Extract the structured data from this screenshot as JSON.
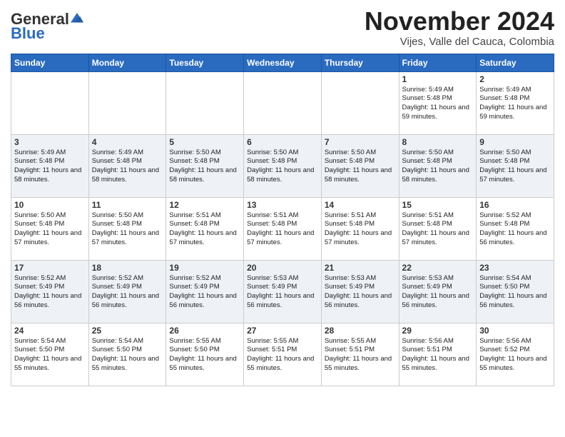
{
  "logo": {
    "general": "General",
    "blue": "Blue"
  },
  "header": {
    "month": "November 2024",
    "location": "Vijes, Valle del Cauca, Colombia"
  },
  "weekdays": [
    "Sunday",
    "Monday",
    "Tuesday",
    "Wednesday",
    "Thursday",
    "Friday",
    "Saturday"
  ],
  "rows": [
    [
      {
        "day": "",
        "text": ""
      },
      {
        "day": "",
        "text": ""
      },
      {
        "day": "",
        "text": ""
      },
      {
        "day": "",
        "text": ""
      },
      {
        "day": "",
        "text": ""
      },
      {
        "day": "1",
        "text": "Sunrise: 5:49 AM\nSunset: 5:48 PM\nDaylight: 11 hours and 59 minutes."
      },
      {
        "day": "2",
        "text": "Sunrise: 5:49 AM\nSunset: 5:48 PM\nDaylight: 11 hours and 59 minutes."
      }
    ],
    [
      {
        "day": "3",
        "text": "Sunrise: 5:49 AM\nSunset: 5:48 PM\nDaylight: 11 hours and 58 minutes."
      },
      {
        "day": "4",
        "text": "Sunrise: 5:49 AM\nSunset: 5:48 PM\nDaylight: 11 hours and 58 minutes."
      },
      {
        "day": "5",
        "text": "Sunrise: 5:50 AM\nSunset: 5:48 PM\nDaylight: 11 hours and 58 minutes."
      },
      {
        "day": "6",
        "text": "Sunrise: 5:50 AM\nSunset: 5:48 PM\nDaylight: 11 hours and 58 minutes."
      },
      {
        "day": "7",
        "text": "Sunrise: 5:50 AM\nSunset: 5:48 PM\nDaylight: 11 hours and 58 minutes."
      },
      {
        "day": "8",
        "text": "Sunrise: 5:50 AM\nSunset: 5:48 PM\nDaylight: 11 hours and 58 minutes."
      },
      {
        "day": "9",
        "text": "Sunrise: 5:50 AM\nSunset: 5:48 PM\nDaylight: 11 hours and 57 minutes."
      }
    ],
    [
      {
        "day": "10",
        "text": "Sunrise: 5:50 AM\nSunset: 5:48 PM\nDaylight: 11 hours and 57 minutes."
      },
      {
        "day": "11",
        "text": "Sunrise: 5:50 AM\nSunset: 5:48 PM\nDaylight: 11 hours and 57 minutes."
      },
      {
        "day": "12",
        "text": "Sunrise: 5:51 AM\nSunset: 5:48 PM\nDaylight: 11 hours and 57 minutes."
      },
      {
        "day": "13",
        "text": "Sunrise: 5:51 AM\nSunset: 5:48 PM\nDaylight: 11 hours and 57 minutes."
      },
      {
        "day": "14",
        "text": "Sunrise: 5:51 AM\nSunset: 5:48 PM\nDaylight: 11 hours and 57 minutes."
      },
      {
        "day": "15",
        "text": "Sunrise: 5:51 AM\nSunset: 5:48 PM\nDaylight: 11 hours and 57 minutes."
      },
      {
        "day": "16",
        "text": "Sunrise: 5:52 AM\nSunset: 5:48 PM\nDaylight: 11 hours and 56 minutes."
      }
    ],
    [
      {
        "day": "17",
        "text": "Sunrise: 5:52 AM\nSunset: 5:49 PM\nDaylight: 11 hours and 56 minutes."
      },
      {
        "day": "18",
        "text": "Sunrise: 5:52 AM\nSunset: 5:49 PM\nDaylight: 11 hours and 56 minutes."
      },
      {
        "day": "19",
        "text": "Sunrise: 5:52 AM\nSunset: 5:49 PM\nDaylight: 11 hours and 56 minutes."
      },
      {
        "day": "20",
        "text": "Sunrise: 5:53 AM\nSunset: 5:49 PM\nDaylight: 11 hours and 56 minutes."
      },
      {
        "day": "21",
        "text": "Sunrise: 5:53 AM\nSunset: 5:49 PM\nDaylight: 11 hours and 56 minutes."
      },
      {
        "day": "22",
        "text": "Sunrise: 5:53 AM\nSunset: 5:49 PM\nDaylight: 11 hours and 56 minutes."
      },
      {
        "day": "23",
        "text": "Sunrise: 5:54 AM\nSunset: 5:50 PM\nDaylight: 11 hours and 56 minutes."
      }
    ],
    [
      {
        "day": "24",
        "text": "Sunrise: 5:54 AM\nSunset: 5:50 PM\nDaylight: 11 hours and 55 minutes."
      },
      {
        "day": "25",
        "text": "Sunrise: 5:54 AM\nSunset: 5:50 PM\nDaylight: 11 hours and 55 minutes."
      },
      {
        "day": "26",
        "text": "Sunrise: 5:55 AM\nSunset: 5:50 PM\nDaylight: 11 hours and 55 minutes."
      },
      {
        "day": "27",
        "text": "Sunrise: 5:55 AM\nSunset: 5:51 PM\nDaylight: 11 hours and 55 minutes."
      },
      {
        "day": "28",
        "text": "Sunrise: 5:55 AM\nSunset: 5:51 PM\nDaylight: 11 hours and 55 minutes."
      },
      {
        "day": "29",
        "text": "Sunrise: 5:56 AM\nSunset: 5:51 PM\nDaylight: 11 hours and 55 minutes."
      },
      {
        "day": "30",
        "text": "Sunrise: 5:56 AM\nSunset: 5:52 PM\nDaylight: 11 hours and 55 minutes."
      }
    ]
  ]
}
